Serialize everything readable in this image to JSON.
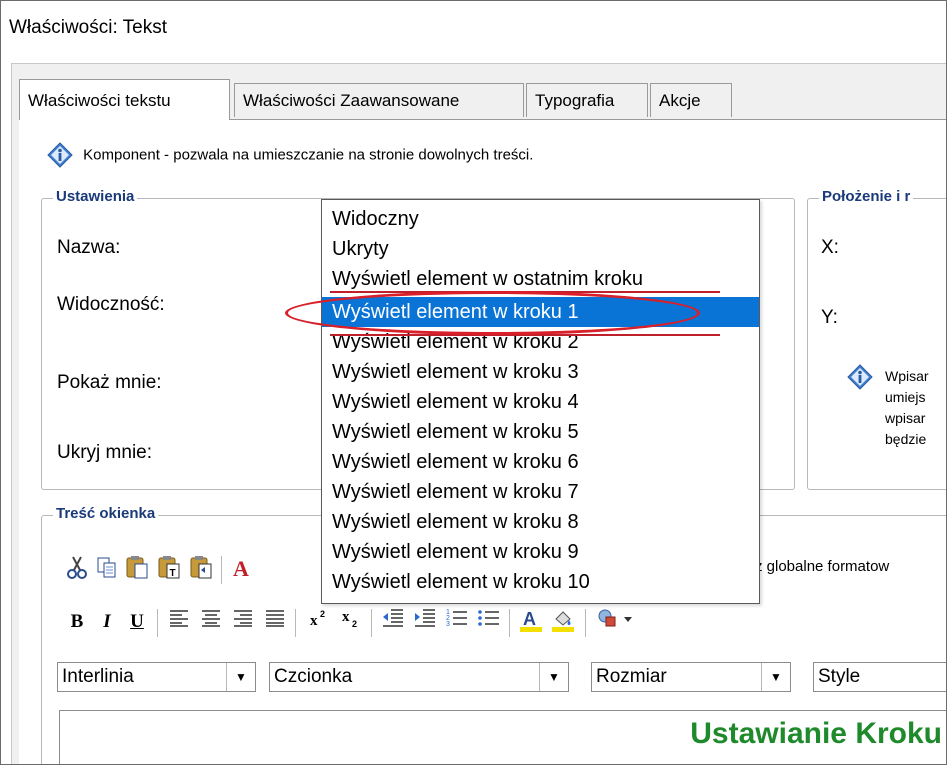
{
  "window": {
    "title": "Właściwości: Tekst"
  },
  "tabs": [
    {
      "label": "Właściwości tekstu",
      "active": true
    },
    {
      "label": "Właściwości Zaawansowane",
      "active": false
    },
    {
      "label": "Typografia",
      "active": false
    },
    {
      "label": "Akcje",
      "active": false
    }
  ],
  "info": {
    "text": "Komponent - pozwala na umieszczanie na stronie dowolnych treści."
  },
  "settings": {
    "legend": "Ustawienia",
    "name_label": "Nazwa:",
    "visibility_label": "Widoczność:",
    "show_me_label": "Pokaż mnie:",
    "hide_me_label": "Ukryj mnie:"
  },
  "position": {
    "legend": "Położenie i r",
    "x_label": "X:",
    "y_label": "Y:",
    "hint_lines": [
      "Wpisar",
      "umiejs",
      "wpisar",
      "będzie"
    ]
  },
  "visibility_dropdown": {
    "options": [
      "Widoczny",
      "Ukryty",
      "Wyświetl element w ostatnim kroku",
      "Wyświetl element w kroku 1",
      "Wyświetl element w kroku 2",
      "Wyświetl element w kroku 3",
      "Wyświetl element w kroku 4",
      "Wyświetl element w kroku 5",
      "Wyświetl element w kroku 6",
      "Wyświetl element w kroku 7",
      "Wyświetl element w kroku 8",
      "Wyświetl element w kroku 9",
      "Wyświetl element w kroku 10"
    ],
    "selected_index": 3
  },
  "content_box": {
    "legend": "Treść okienka",
    "global_format_text": "z globalne formatow"
  },
  "format_toolbar": {
    "bold": "B",
    "italic": "I",
    "underline": "U"
  },
  "selects": {
    "line_height": "Interlinia",
    "font": "Czcionka",
    "size": "Rozmiar",
    "style": "Style"
  },
  "editor": {
    "headline": "Ustawianie Kroku"
  },
  "colors": {
    "accent_selected": "#0a74d6",
    "legend_text": "#1a3a7a",
    "annotation_red": "#d81f2a",
    "headline_green": "#1f8a2b"
  }
}
